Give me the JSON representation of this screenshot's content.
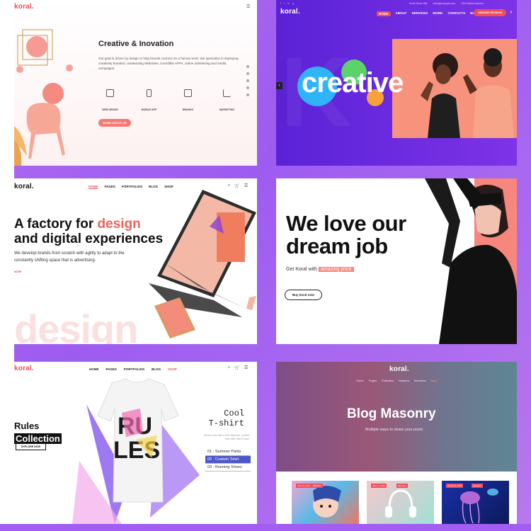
{
  "panel1": {
    "logo": "koral.",
    "title": "Creative & Inovation",
    "description": "Our goal is driven by design to help brands connect on a human level. We specialize in deploying creatively branded, outstanding WebSites, incredible APPs, online advertising and media campaigns.",
    "features": [
      {
        "icon": "web-design-icon",
        "label": "WEB DESIGN"
      },
      {
        "icon": "mobile-app-icon",
        "label": "MOBILE APP"
      },
      {
        "icon": "brands-icon",
        "label": "BRANDS"
      },
      {
        "icon": "marketing-icon",
        "label": "MARKETING"
      }
    ],
    "button": "MORE ABOUT US"
  },
  "panel2": {
    "contact_email": "hello@example.com",
    "contact_phone": "Koral Demo Site",
    "contact_address": "1024 Street Address",
    "logo": "koral.",
    "nav": [
      "HOME",
      "ABOUT",
      "SERVICES",
      "WORK",
      "CONTACTS",
      "BLOG"
    ],
    "buy_button": "AMAZING REVIEWS",
    "hero_word": "creative"
  },
  "panel3": {
    "logo": "koral.",
    "nav": [
      "HOME",
      "PAGES",
      "PORTFOLIOS",
      "BLOG",
      "SHOP"
    ],
    "heading_line1_prefix": "A factory for ",
    "heading_line1_accent": "design",
    "heading_line2": "and digital experiences",
    "description": "We develop brands from scratch with agility to adapt to the constantly shifting space that is advertising.",
    "link": "MORE",
    "bg_word": "design"
  },
  "panel4": {
    "heading_line1": "We love our",
    "heading_line2": "dream job",
    "get_text": "Get Koral with",
    "get_tag": "amazing price",
    "button": "Buy koral now"
  },
  "panel5": {
    "logo": "koral.",
    "nav": [
      "HOME",
      "PAGES",
      "PORTFOLIOS",
      "BLOG",
      "SHOP"
    ],
    "heading_line1": "Rules",
    "heading_line2": "Collection",
    "button": "EXPLORE NOW",
    "tshirt_word1": "RU",
    "tshirt_word2": "LES",
    "cool_line1": "Cool",
    "cool_line2": "T-shirt",
    "sub": "Get the new with a 20% discount. Limited time offer, take it now!",
    "list": [
      "01 - Summer Pants",
      "02 - Custom Tshirt",
      "03 - Running Shoes"
    ]
  },
  "panel6": {
    "logo": "koral.",
    "nav": [
      "Home",
      "Pages",
      "Portfolios",
      "Headers",
      "Elements",
      "Blog"
    ],
    "title": "Blog Masonry",
    "subtitle": "Multiple ways to share your posts",
    "cards": [
      {
        "date": "JULY 8, 2016",
        "tag": "DESIGN"
      },
      {
        "date": "JULY 2, 2016",
        "tag": "DESIGN"
      },
      {
        "date": "JUNE 20, 2016",
        "tag": "DESIGN"
      }
    ]
  }
}
